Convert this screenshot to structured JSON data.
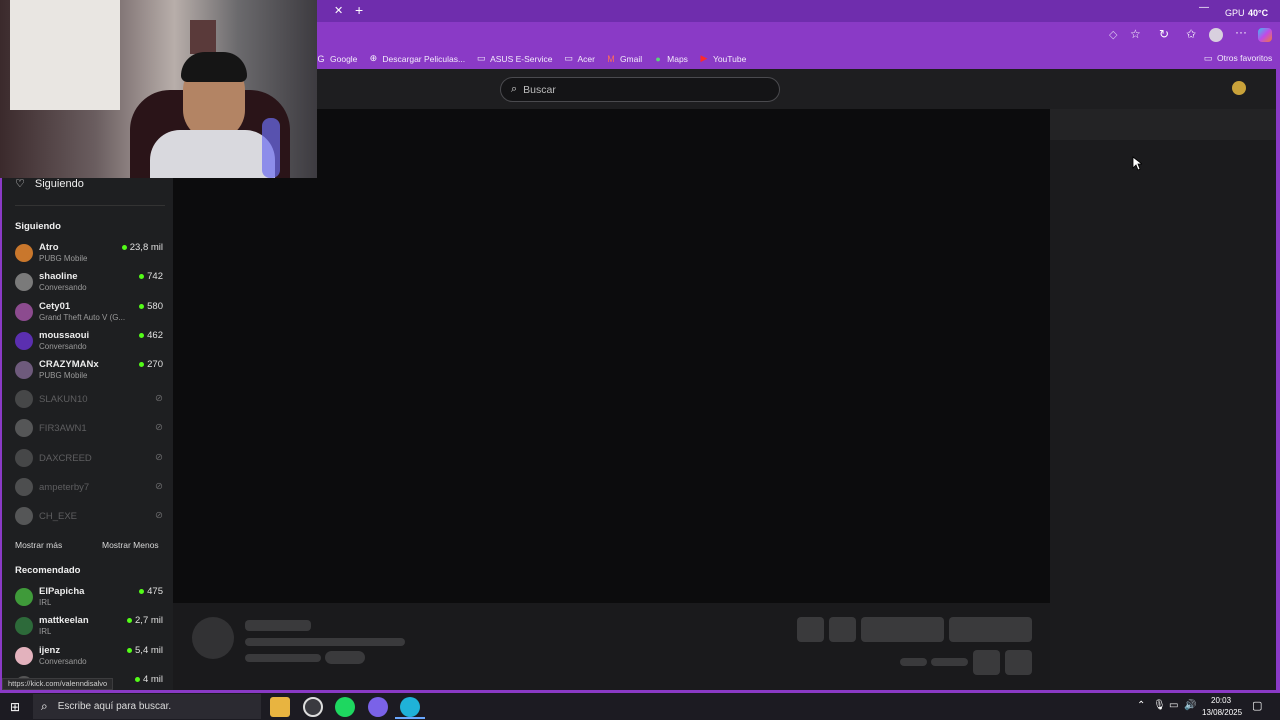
{
  "browser": {
    "bookmarks": [
      {
        "label": "Google",
        "icon": "google-icon"
      },
      {
        "label": "Descargar Peliculas...",
        "icon": "globe-icon"
      },
      {
        "label": "ASUS E-Service",
        "icon": "folder-icon"
      },
      {
        "label": "Acer",
        "icon": "folder-icon"
      },
      {
        "label": "Gmail",
        "icon": "gmail-icon"
      },
      {
        "label": "Maps",
        "icon": "maps-icon"
      },
      {
        "label": "YouTube",
        "icon": "youtube-icon"
      }
    ],
    "other_favorites": "Otros favoritos",
    "gpu_label": "GPU",
    "gpu_temp": "40°C",
    "status_url": "https://kick.com/valenndisalvo"
  },
  "site": {
    "search_placeholder": "Buscar",
    "following_nav_label": "Siguiendo",
    "following_section": "Siguiendo",
    "following": [
      {
        "name": "Atro",
        "sub": "PUBG Mobile",
        "viewers": "23,8 mil",
        "color": "#c9772c"
      },
      {
        "name": "shaoline",
        "sub": "Conversando",
        "viewers": "742",
        "color": "#7a7a7a"
      },
      {
        "name": "Cety01",
        "sub": "Grand Theft Auto V (G...",
        "viewers": "580",
        "color": "#8c4b8f"
      },
      {
        "name": "moussaoui",
        "sub": "Conversando",
        "viewers": "462",
        "color": "#5b2fb0"
      },
      {
        "name": "CRAZYMANx",
        "sub": "PUBG Mobile",
        "viewers": "270",
        "color": "#6e5a7c"
      }
    ],
    "offline": [
      {
        "name": "SLAKUN10",
        "color": "#777777"
      },
      {
        "name": "FIR3AWN1",
        "color": "#999999"
      },
      {
        "name": "DAXCREED",
        "color": "#777777"
      },
      {
        "name": "ampeterby7",
        "color": "#888888"
      },
      {
        "name": "CH_EXE",
        "color": "#999999"
      }
    ],
    "show_more": "Mostrar más",
    "show_less": "Mostrar Menos",
    "recommended_section": "Recomendado",
    "recommended": [
      {
        "name": "ElPapicha",
        "sub": "IRL",
        "viewers": "475",
        "color": "#3f9a3a"
      },
      {
        "name": "mattkeelan",
        "sub": "IRL",
        "viewers": "2,7 mil",
        "color": "#2d6a3a"
      },
      {
        "name": "ijenz",
        "sub": "Conversando",
        "viewers": "5,4 mil",
        "color": "#e3b2bd"
      },
      {
        "name": "",
        "sub": "",
        "viewers": "4 mil",
        "color": "#555555"
      }
    ]
  },
  "taskbar": {
    "search_placeholder": "Escribe aquí para buscar.",
    "time": "20:03",
    "date": "13/08/2025"
  },
  "colors": {
    "accent": "#8a3ac6",
    "live": "#53fc18"
  }
}
